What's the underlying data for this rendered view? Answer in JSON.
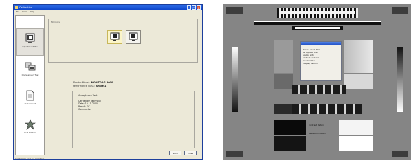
{
  "window": {
    "title": "Calibration",
    "controls": [
      "_",
      "□",
      "x"
    ],
    "menu": [
      "File",
      "View",
      "Help"
    ]
  },
  "sidebar": {
    "items": [
      {
        "label": "Adjustment Test",
        "icon": "monitor-icon",
        "active": true
      },
      {
        "label": "Comparison Test",
        "icon": "dual-monitor-icon",
        "active": false
      },
      {
        "label": "Test Report",
        "icon": "document-icon",
        "active": false
      },
      {
        "label": "Test Pattern",
        "icon": "pattern-icon",
        "active": false
      }
    ]
  },
  "content": {
    "monitor_group_caption": "Monitors",
    "monitors": [
      {
        "name": "monitor-1",
        "selected": true
      },
      {
        "name": "monitor-2",
        "selected": false
      }
    ],
    "info": [
      {
        "label": "Monitor Model:",
        "value": "MONITOR-1 9000"
      },
      {
        "label": "Performance Class:",
        "value": "Grade 1"
      }
    ],
    "result": {
      "title": "Acceptance Test",
      "lines": [
        "Carried by: Technical",
        "Date: 10.11.2000",
        "Result: OK",
        "Comments:"
      ]
    },
    "buttons": {
      "primary": "Save",
      "secondary": "Close"
    }
  },
  "statusbar": {
    "text": "Calibration tool for monitors"
  },
  "pattern": {
    "dialog_lines": [
      "Please check that",
      "all squares are",
      "visible with",
      "distinct contrast",
      "levels in the",
      "display pattern."
    ],
    "label_left": "Contrast Pattern",
    "label_right": "Resolution Pattern",
    "colors": {
      "background": "#858585",
      "dialog": "#f1efe8"
    }
  }
}
